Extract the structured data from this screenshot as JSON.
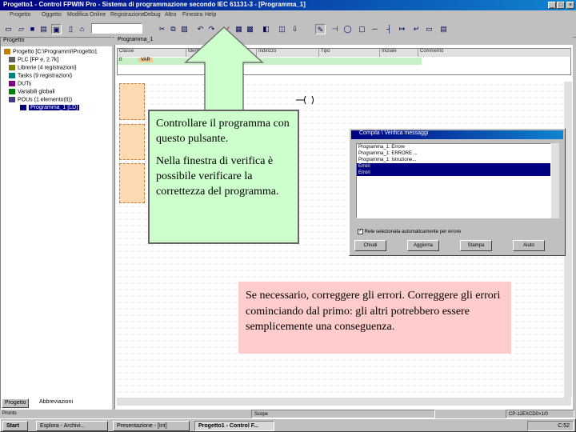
{
  "window": {
    "title": "Progetto1 - Control FPWIN Pro - Sistema di programmazione secondo IEC 61131-3 - [Programma_1]",
    "minimize_glyph": "_",
    "maximize_glyph": "□",
    "close_glyph": "×"
  },
  "menu": [
    "Progetto",
    "Oggetto",
    "Modifica",
    "Online",
    "Registrazione",
    "Debug",
    "Altro",
    "Finestra",
    "Help"
  ],
  "project_panel": {
    "title": "Progetto",
    "tree": [
      {
        "label": "Progetto [C:\\Programmi\\Progetto1",
        "icon": "project-icon",
        "indent": 0
      },
      {
        "label": "PLC [FP e, 2.7k]",
        "icon": "plc-icon",
        "indent": 1
      },
      {
        "label": "Librerie (4 registrazioni)",
        "icon": "library-icon",
        "indent": 1
      },
      {
        "label": "Tasks (9 registrazioni)",
        "icon": "tasks-icon",
        "indent": 1
      },
      {
        "label": "DUTs",
        "icon": "dut-icon",
        "indent": 1
      },
      {
        "label": "Variabili globali",
        "icon": "globals-icon",
        "indent": 1
      },
      {
        "label": "POUs (1 elemento(ti))",
        "icon": "pou-icon",
        "indent": 1
      },
      {
        "label": "Programma_1 [LD]",
        "icon": "program-icon",
        "indent": 2,
        "selected": true
      }
    ],
    "tabs": [
      "Progetto",
      "Abbreviazioni"
    ]
  },
  "editor": {
    "title": "Programma_1",
    "decl_headers": [
      "Classe",
      "Identificatore",
      "Indirizzo",
      "Tipo",
      "Iniziale",
      "Commento"
    ],
    "decl_row": [
      "0",
      "VAR"
    ]
  },
  "dialog": {
    "title": "Compila \\ Verifica messaggi",
    "messages": [
      "Programma_1: Errore",
      "Programma_1: ERRORE ...",
      "Programma_1: Istruzione...",
      "Errori",
      "Errori"
    ],
    "selected_indices": [
      3,
      4
    ],
    "checkbox_label": "Rete selezionata automaticamente per errore",
    "buttons": [
      "Chiudi",
      "Aggiorna",
      "Stampa",
      "Aiuto"
    ]
  },
  "callouts": {
    "green": {
      "line1": "Controllare il programma con questo pulsante.",
      "line2": "Nella finestra di verifica è possibile verificare la correttezza del programma."
    },
    "red": {
      "text": "Se necessario, correggere gli errori. Correggere gli errori cominciando dal primo: gli altri potrebbero essere semplicemente una conseguenza."
    }
  },
  "statusbar": {
    "left": "Pronto",
    "middle": "Scope",
    "right": "CP-12EXCD0>1/0"
  },
  "taskbar": {
    "start": "Start",
    "items": [
      "Esplora - Archivi...",
      "Presentazione - [Int]",
      "Progetto1 - Control F..."
    ],
    "clock": "C:52"
  },
  "colors": {
    "callout_green": "#ccffcc",
    "callout_red": "#ffcccc",
    "arrow_green": "#ccffcc",
    "title_blue": "#000080"
  }
}
